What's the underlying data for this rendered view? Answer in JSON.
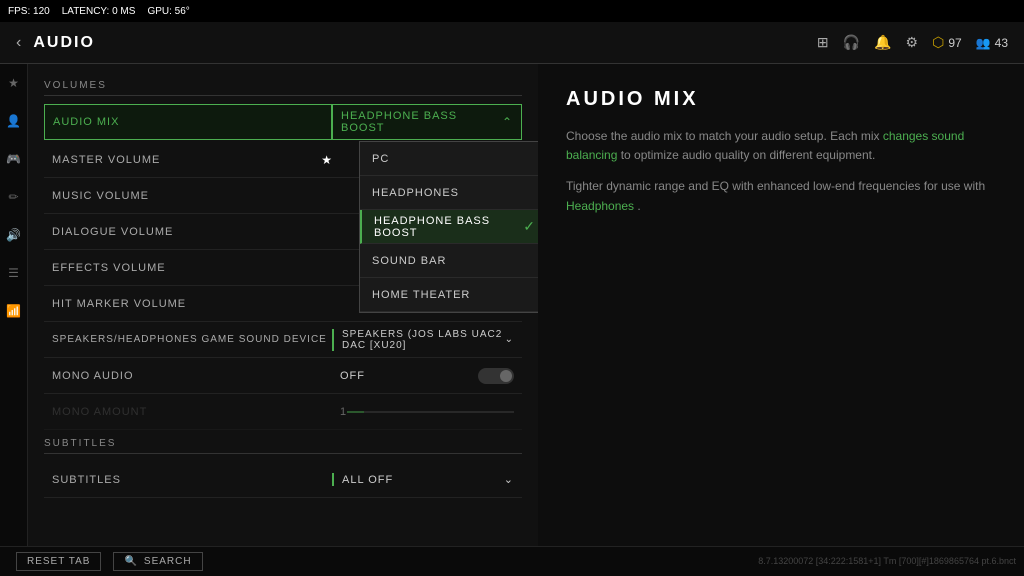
{
  "topbar": {
    "fps_label": "FPS:",
    "fps_value": "120",
    "latency_label": "LATENCY:",
    "latency_value": "0 MS",
    "gpu_label": "GPU:",
    "gpu_value": "56°"
  },
  "header": {
    "back_icon": "‹",
    "title": "AUDIO",
    "icons": [
      "⊞",
      "🎧",
      "🔔",
      "⚙"
    ],
    "battle_level": "97",
    "group_count": "43"
  },
  "sidebar_icons": [
    {
      "name": "star",
      "symbol": "★",
      "active": false
    },
    {
      "name": "person",
      "symbol": "👤",
      "active": false
    },
    {
      "name": "controller",
      "symbol": "🎮",
      "active": false
    },
    {
      "name": "edit",
      "symbol": "✏",
      "active": false
    },
    {
      "name": "speaker",
      "symbol": "🔊",
      "active": true
    },
    {
      "name": "list",
      "symbol": "☰",
      "active": false
    },
    {
      "name": "signal",
      "symbol": "📶",
      "active": false
    }
  ],
  "volumes_section": {
    "label": "VOLUMES",
    "rows": [
      {
        "id": "audio-mix",
        "label": "AUDIO MIX",
        "value": "HEADPHONE BASS BOOST",
        "type": "dropdown-open",
        "active": true
      },
      {
        "id": "master-volume",
        "label": "MASTER VOLUME",
        "value": "",
        "type": "star",
        "starred": true
      },
      {
        "id": "music-volume",
        "label": "MUSIC VOLUME",
        "value": "",
        "type": "plain"
      },
      {
        "id": "dialogue-volume",
        "label": "DIALOGUE VOLUME",
        "value": "",
        "type": "plain"
      },
      {
        "id": "effects-volume",
        "label": "EFFECTS VOLUME",
        "value": "",
        "type": "plain"
      },
      {
        "id": "hit-marker-volume",
        "label": "HIT MARKER VOLUME",
        "value": "",
        "type": "plain"
      },
      {
        "id": "sound-device",
        "label": "SPEAKERS/HEADPHONES GAME SOUND DEVICE",
        "value": "SPEAKERS (JOS LABS UAC2 DAC [XU20]",
        "type": "dropdown"
      },
      {
        "id": "mono-audio",
        "label": "MONO AUDIO",
        "value": "OFF",
        "type": "toggle",
        "enabled": false
      },
      {
        "id": "mono-amount",
        "label": "MONO AMOUNT",
        "value": "1",
        "type": "slider",
        "dimmed": true
      }
    ]
  },
  "audio_mix_dropdown": {
    "items": [
      {
        "label": "PC",
        "selected": false
      },
      {
        "label": "HEADPHONES",
        "selected": false
      },
      {
        "label": "HEADPHONE BASS BOOST",
        "selected": true
      },
      {
        "label": "SOUND BAR",
        "selected": false
      },
      {
        "label": "HOME THEATER",
        "selected": false
      }
    ]
  },
  "subtitles_section": {
    "label": "SUBTITLES",
    "rows": [
      {
        "id": "subtitles",
        "label": "SUBTITLES",
        "value": "ALL OFF",
        "type": "dropdown"
      }
    ]
  },
  "info_panel": {
    "title": "AUDIO MIX",
    "description1": "Choose the audio mix to match your audio setup. Each mix",
    "link1": "changes sound balancing",
    "description1b": " to optimize audio quality on different equipment.",
    "description2": "Tighter dynamic range and EQ with enhanced low-end frequencies for use with",
    "link2": "Headphones",
    "description2b": "."
  },
  "bottom_bar": {
    "reset_label": "RESET TAB",
    "search_label": "SEARCH",
    "search_icon": "🔍"
  },
  "version": "8.7.13200072 [34:222:1581+1] Tm [700][#]1869865764 pt.6.bnct"
}
